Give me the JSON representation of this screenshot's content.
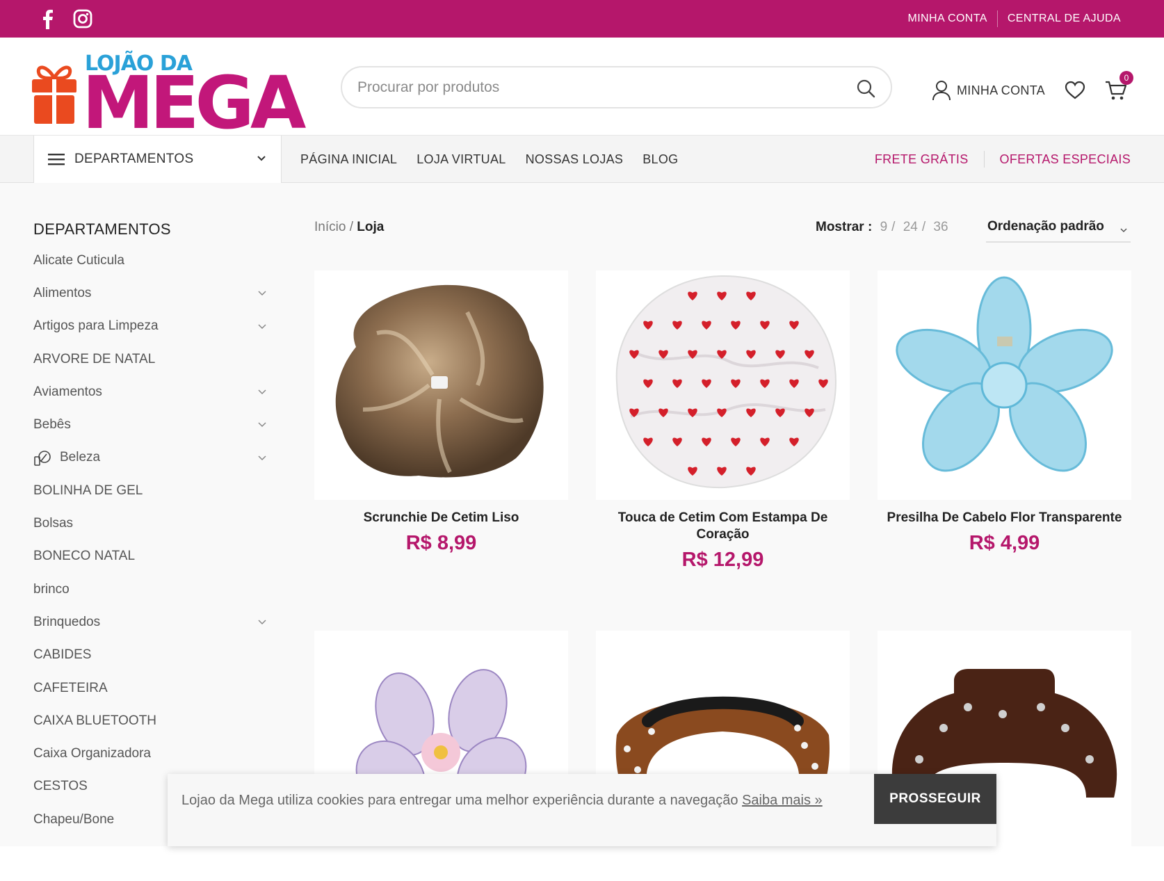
{
  "colors": {
    "brand": "#b5176b",
    "logo_blue": "#2aa1d8",
    "gift_orange": "#ea4a1f"
  },
  "topbar": {
    "social": [
      "facebook-icon",
      "instagram-icon"
    ],
    "links": [
      "MINHA CONTA",
      "CENTRAL DE AJUDA"
    ]
  },
  "logo": {
    "line1": "LOJÃO DA",
    "line2": "MEGA"
  },
  "search": {
    "placeholder": "Procurar por produtos"
  },
  "header": {
    "account_label": "MINHA CONTA",
    "cart_count": "0"
  },
  "nav": {
    "departments_label": "DEPARTAMENTOS",
    "links": [
      "PÁGINA INICIAL",
      "LOJA VIRTUAL",
      "NOSSAS LOJAS",
      "BLOG"
    ],
    "right_links": [
      "FRETE GRÁTIS",
      "OFERTAS ESPECIAIS"
    ]
  },
  "sidebar": {
    "title": "DEPARTAMENTOS",
    "items": [
      {
        "label": "Alicate Cuticula",
        "expandable": false
      },
      {
        "label": "Alimentos",
        "expandable": true
      },
      {
        "label": "Artigos para Limpeza",
        "expandable": true
      },
      {
        "label": "ARVORE DE NATAL",
        "expandable": false
      },
      {
        "label": "Aviamentos",
        "expandable": true
      },
      {
        "label": "Bebês",
        "expandable": true
      },
      {
        "label": "Beleza",
        "expandable": true,
        "icon": "makeup-icon"
      },
      {
        "label": "BOLINHA DE GEL",
        "expandable": false
      },
      {
        "label": "Bolsas",
        "expandable": false
      },
      {
        "label": "BONECO NATAL",
        "expandable": false
      },
      {
        "label": "brinco",
        "expandable": false
      },
      {
        "label": "Brinquedos",
        "expandable": true
      },
      {
        "label": "CABIDES",
        "expandable": false
      },
      {
        "label": "CAFETEIRA",
        "expandable": false
      },
      {
        "label": "CAIXA BLUETOOTH",
        "expandable": false
      },
      {
        "label": "Caixa Organizadora",
        "expandable": false
      },
      {
        "label": "CESTOS",
        "expandable": false
      },
      {
        "label": "Chapeu/Bone",
        "expandable": false
      }
    ]
  },
  "breadcrumb": {
    "home": "Início",
    "sep": "/",
    "current": "Loja"
  },
  "perpage": {
    "label": "Mostrar :",
    "options": [
      "9",
      "24",
      "36"
    ]
  },
  "ordering": {
    "selected": "Ordenação padrão"
  },
  "products": [
    {
      "name": "Scrunchie De Cetim Liso",
      "price": "R$ 8,99",
      "image": "scrunchie"
    },
    {
      "name": "Touca de Cetim Com Estampa De Coração",
      "price": "R$ 12,99",
      "image": "bonnet"
    },
    {
      "name": "Presilha De Cabelo Flor Transparente",
      "price": "R$ 4,99",
      "image": "flower-clip"
    },
    {
      "name": "",
      "price": "",
      "image": "purple-flower-clip"
    },
    {
      "name": "",
      "price": "",
      "image": "headband"
    },
    {
      "name": "",
      "price": "",
      "image": "brown-claw-clip"
    }
  ],
  "cookie": {
    "message": "Lojao da Mega utiliza cookies para entregar uma melhor experiência durante a navegação",
    "link": "Saiba mais »",
    "button": "PROSSEGUIR"
  }
}
